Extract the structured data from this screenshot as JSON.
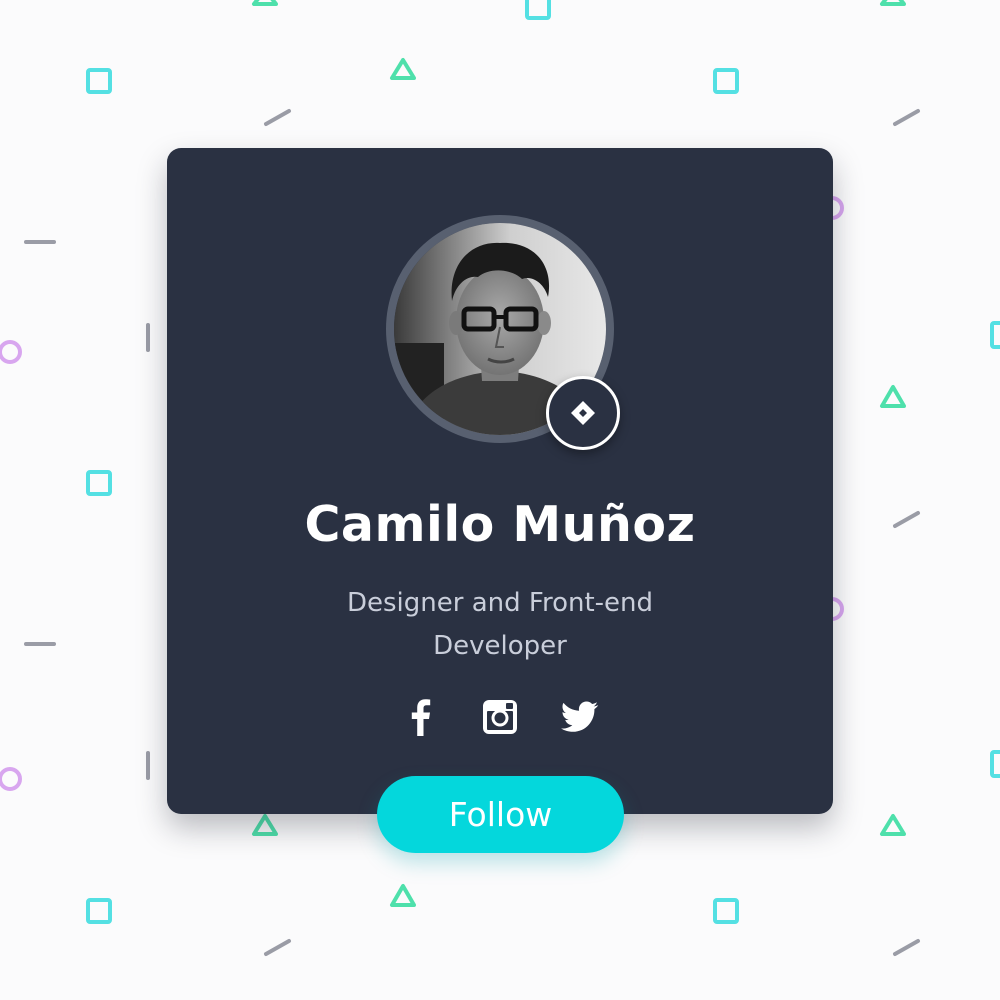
{
  "profile": {
    "name": "Camilo Muñoz",
    "role": "Designer and Front-end Developer",
    "avatar": "profile-photo",
    "badge_icon": "diamond-icon"
  },
  "social": [
    {
      "icon": "facebook-icon"
    },
    {
      "icon": "instagram-icon"
    },
    {
      "icon": "twitter-icon"
    }
  ],
  "actions": {
    "follow_label": "Follow"
  },
  "colors": {
    "background": "#fbfbfc",
    "card": "#2a3142",
    "accent": "#04d7dc",
    "shape_square": "#54e0e3",
    "shape_triangle": "#4ee0ab",
    "shape_circle": "#d8a6ef",
    "shape_dash": "#9a9ca6"
  }
}
